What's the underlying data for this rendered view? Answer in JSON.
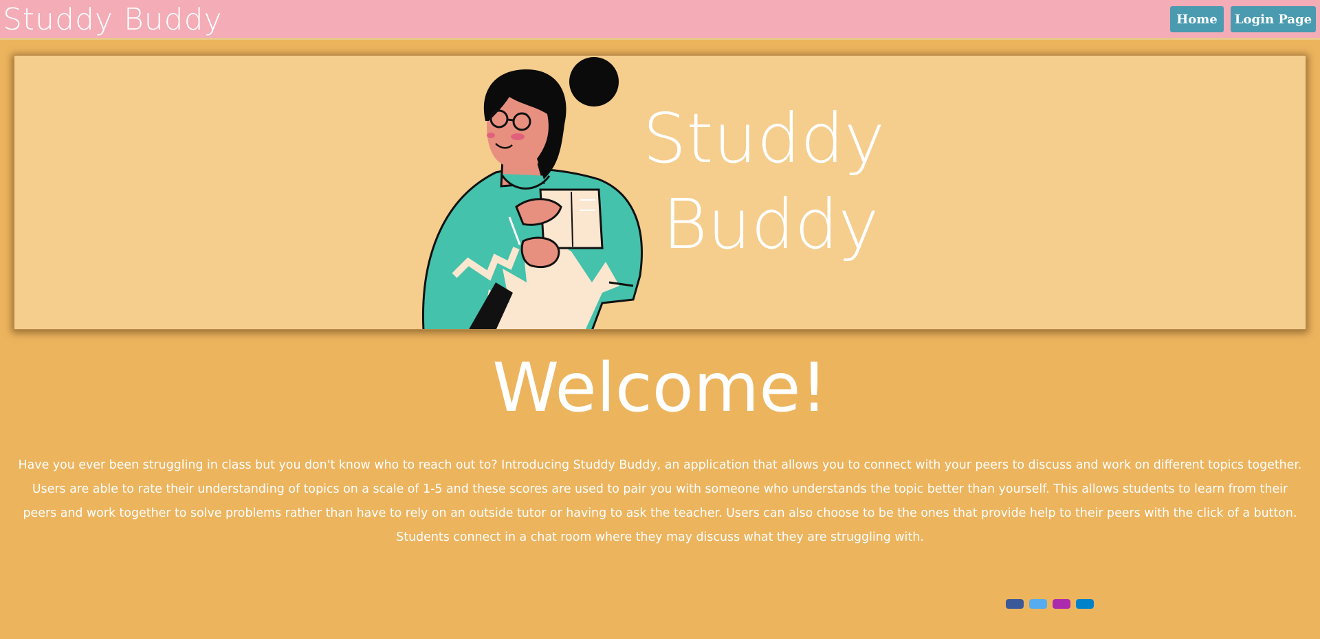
{
  "navbar": {
    "brand": "Studdy Buddy",
    "home_label": "Home",
    "login_label": "Login Page"
  },
  "hero": {
    "logo_line1": "Studdy",
    "logo_line2": "Buddy"
  },
  "main": {
    "heading": "Welcome!",
    "intro": "Have you ever been struggling in class but you don't know who to reach out to? Introducing Studdy Buddy, an application that allows you to connect with your peers to discuss and work on different topics together. Users are able to rate their understanding of topics on a scale of 1-5 and these scores are used to pair you with someone who understands the topic better than yourself. This allows students to learn from their peers and work together to solve problems rather than have to rely on an outside tutor or having to ask the teacher. Users can also choose to be the ones that provide help to their peers with the click of a button. Students connect in a chat room where they may discuss what they are struggling with."
  },
  "socials": [
    {
      "icon": "facebook-icon",
      "color": "#3b5998"
    },
    {
      "icon": "twitter-icon",
      "color": "#55acee"
    },
    {
      "icon": "instagram-icon",
      "color": "#ac2bac"
    },
    {
      "icon": "linkedin-icon",
      "color": "#0082ca"
    }
  ],
  "colors": {
    "navbar_bg": "#f4acb7",
    "page_bg": "#edb45e",
    "hero_bg": "#f5cd8d",
    "button_bg": "#4a9bb0"
  }
}
